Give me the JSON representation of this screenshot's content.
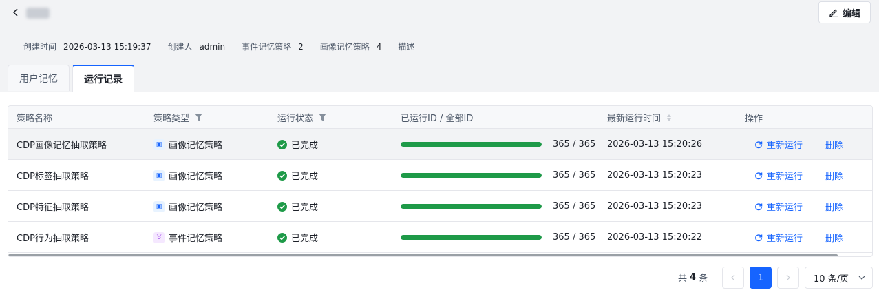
{
  "header": {
    "edit_label": "编辑",
    "meta": [
      {
        "key": "创建时间",
        "value": "2026-03-13 15:19:37"
      },
      {
        "key": "创建人",
        "value": "admin"
      },
      {
        "key": "事件记忆策略",
        "value": "2"
      },
      {
        "key": "画像记忆策略",
        "value": "4"
      },
      {
        "key": "描述",
        "value": ""
      }
    ]
  },
  "tabs": [
    {
      "label": "用户记忆",
      "active": false
    },
    {
      "label": "运行记录",
      "active": true
    }
  ],
  "table": {
    "columns": {
      "name": "策略名称",
      "type": "策略类型",
      "status": "运行状态",
      "progress": "已运行ID / 全部ID",
      "time": "最新运行时间",
      "actions": "操作"
    },
    "rows": [
      {
        "name": "CDP画像记忆抽取策略",
        "type": "画像记忆策略",
        "type_icon": "portrait-icon",
        "status": "已完成",
        "progress_text": "365 / 365",
        "progress": 1.0,
        "time": "2026-03-13 15:20:26",
        "rerun": "重新运行",
        "delete": "删除"
      },
      {
        "name": "CDP标签抽取策略",
        "type": "画像记忆策略",
        "type_icon": "portrait-icon",
        "status": "已完成",
        "progress_text": "365 / 365",
        "progress": 1.0,
        "time": "2026-03-13 15:20:23",
        "rerun": "重新运行",
        "delete": "删除"
      },
      {
        "name": "CDP特征抽取策略",
        "type": "画像记忆策略",
        "type_icon": "portrait-icon",
        "status": "已完成",
        "progress_text": "365 / 365",
        "progress": 1.0,
        "time": "2026-03-13 15:20:23",
        "rerun": "重新运行",
        "delete": "删除"
      },
      {
        "name": "CDP行为抽取策略",
        "type": "事件记忆策略",
        "type_icon": "event-icon",
        "status": "已完成",
        "progress_text": "365 / 365",
        "progress": 1.0,
        "time": "2026-03-13 15:20:22",
        "rerun": "重新运行",
        "delete": "删除"
      }
    ]
  },
  "pagination": {
    "total_prefix": "共",
    "total": "4",
    "total_suffix": "条",
    "current_page": "1",
    "prev": "<",
    "next": ">",
    "page_size": "10 条/页"
  },
  "colors": {
    "accent": "#1664ff",
    "success": "#1e9a48",
    "header_bg": "#f2f3f5"
  }
}
